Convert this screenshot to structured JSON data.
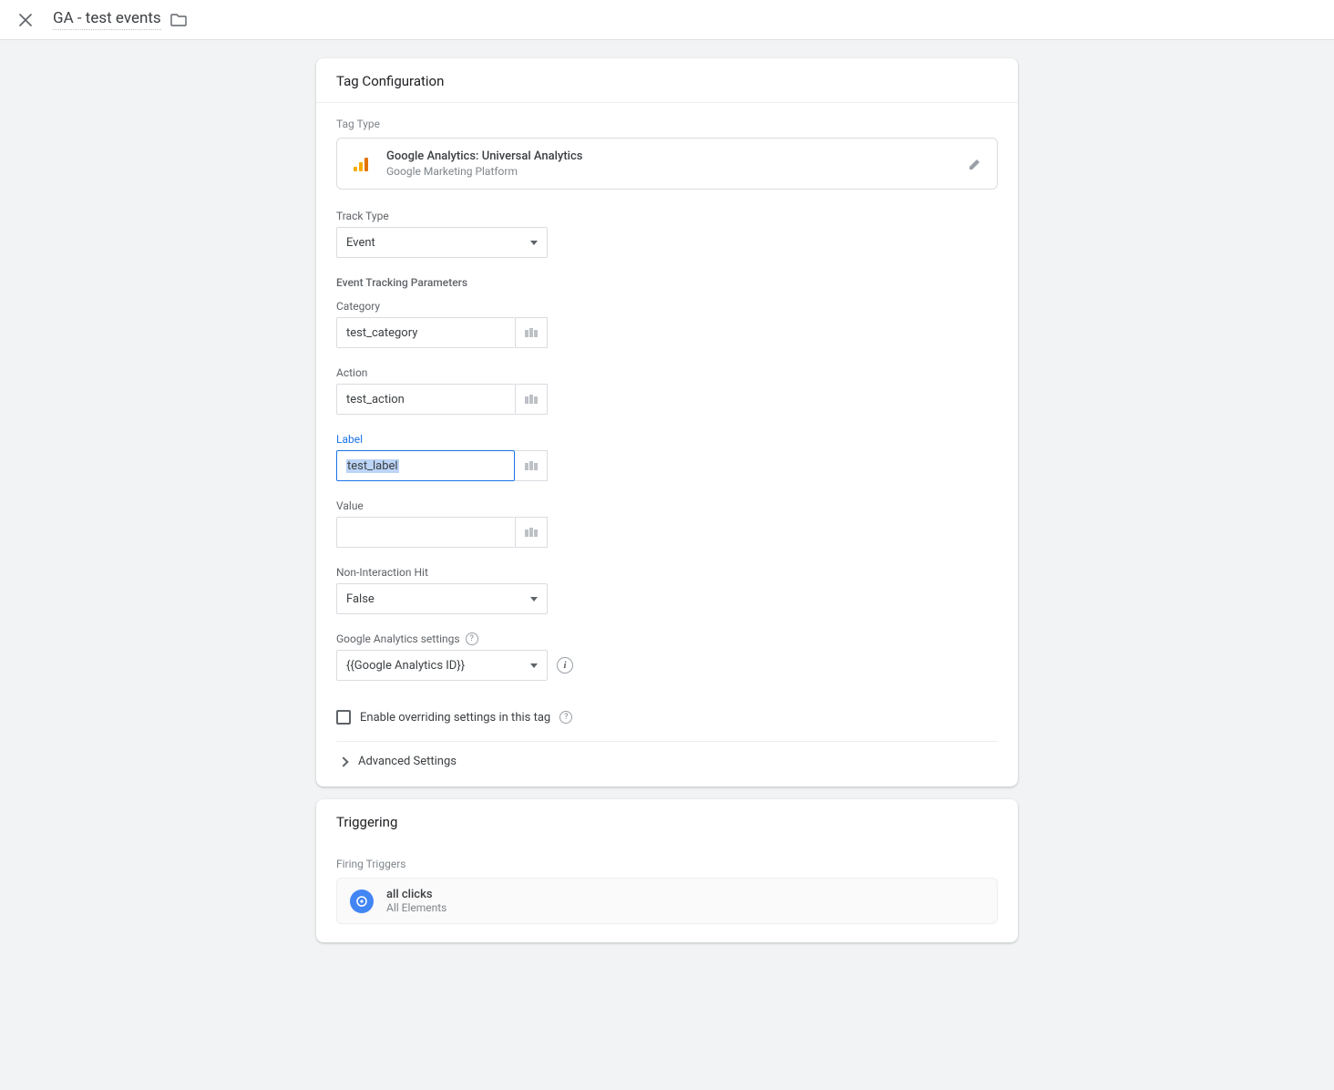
{
  "header": {
    "title": "GA - test events"
  },
  "tagConfig": {
    "sectionTitle": "Tag Configuration",
    "tagTypeLabel": "Tag Type",
    "tagType": {
      "name": "Google Analytics: Universal Analytics",
      "platform": "Google Marketing Platform"
    },
    "trackTypeLabel": "Track Type",
    "trackTypeValue": "Event",
    "paramsHeading": "Event Tracking Parameters",
    "category": {
      "label": "Category",
      "value": "test_category"
    },
    "action": {
      "label": "Action",
      "value": "test_action"
    },
    "labelField": {
      "label": "Label",
      "value": "test_label"
    },
    "valueField": {
      "label": "Value",
      "value": ""
    },
    "nonInteraction": {
      "label": "Non-Interaction Hit",
      "value": "False"
    },
    "gaSettings": {
      "label": "Google Analytics settings",
      "value": "{{Google Analytics ID}}"
    },
    "overrideCheckbox": "Enable overriding settings in this tag",
    "advancedSettings": "Advanced Settings"
  },
  "triggering": {
    "sectionTitle": "Triggering",
    "firingLabel": "Firing Triggers",
    "trigger": {
      "name": "all clicks",
      "type": "All Elements"
    }
  }
}
